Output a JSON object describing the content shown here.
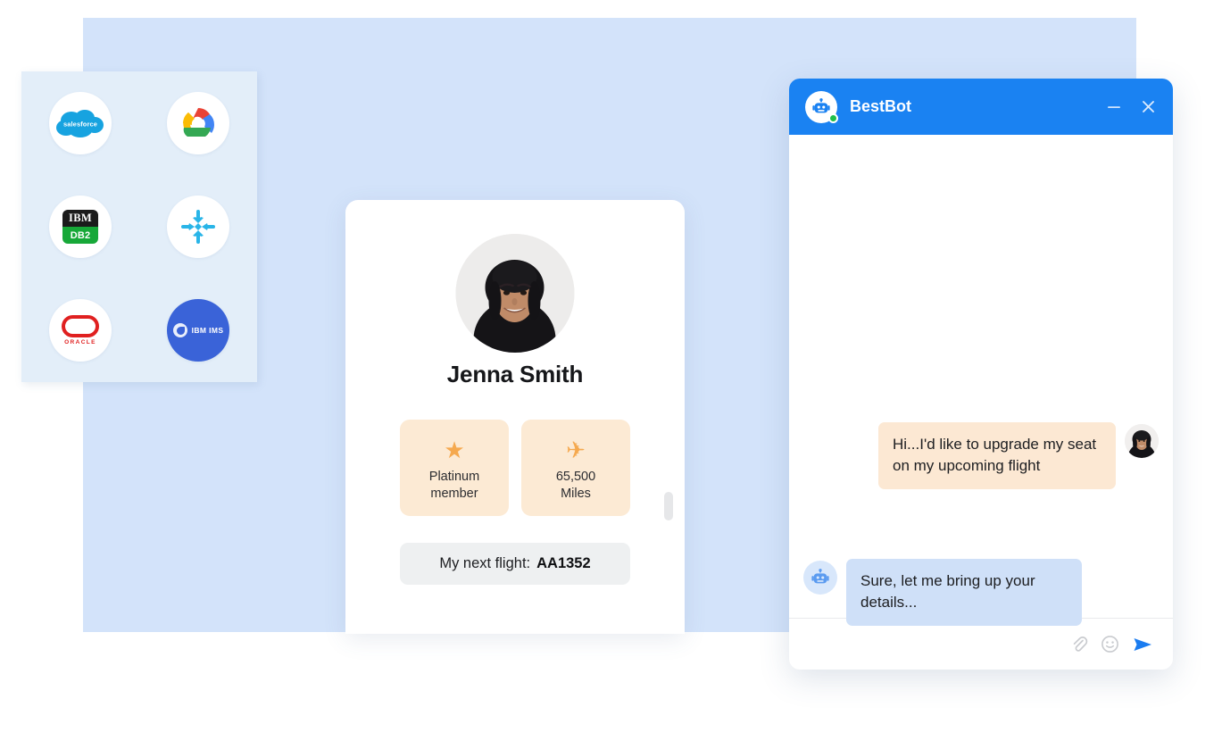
{
  "background": {
    "panel_color": "#d3e3fa",
    "page_color": "#ffffff"
  },
  "integrations_panel": {
    "name": "data-sources-panel",
    "background_color": "#e3eef9",
    "items": [
      {
        "id": "salesforce",
        "label": "salesforce",
        "icon": "salesforce-cloud-icon",
        "color": "#17a3e0"
      },
      {
        "id": "google-cloud",
        "label": "Google Cloud",
        "icon": "google-cloud-icon",
        "color": "#4285f4"
      },
      {
        "id": "ibm-db2",
        "label_top": "IBM",
        "label_bottom": "DB2",
        "icon": "ibm-db2-icon",
        "color": "#17a838"
      },
      {
        "id": "snowflake",
        "label": "Snowflake",
        "icon": "snowflake-icon",
        "color": "#29b5e8"
      },
      {
        "id": "oracle",
        "label": "ORACLE",
        "icon": "oracle-icon",
        "color": "#e02020"
      },
      {
        "id": "ibm-ims",
        "label": "IBM IMS",
        "icon": "ibm-ims-icon",
        "color": "#3a63d8"
      }
    ]
  },
  "profile_card": {
    "name": "Jenna Smith",
    "avatar_alt": "Jenna Smith portrait photo",
    "badges": [
      {
        "icon": "star-icon",
        "glyph": "★",
        "label": "Platinum\nmember",
        "line1": "Platinum",
        "line2": "member"
      },
      {
        "icon": "airplane-icon",
        "glyph": "✈",
        "label": "65,500\nMiles",
        "line1": "65,500",
        "line2": "Miles"
      }
    ],
    "next_flight": {
      "label": "My next flight:",
      "value": "AA1352"
    },
    "badge_bg_color": "#fcead4",
    "badge_icon_color": "#f5a94f"
  },
  "chat_window": {
    "title": "BestBot",
    "header_color": "#1a82f2",
    "status": "online",
    "status_color": "#1fc04a",
    "bot_avatar_icon": "robot-icon",
    "controls": {
      "minimize": "—",
      "close": "✕"
    },
    "messages": [
      {
        "sender": "user",
        "text": "Hi...I'd like to upgrade my seat on my upcoming flight",
        "bubble_color": "#fce8d3",
        "avatar": "user-photo-avatar"
      },
      {
        "sender": "bot",
        "text": "Sure, let me bring up your details...",
        "bubble_color": "#cfe0f8",
        "avatar": "robot-icon"
      }
    ],
    "footer_actions": [
      {
        "id": "attach",
        "icon": "paperclip-icon",
        "color": "#c9cbcf"
      },
      {
        "id": "emoji",
        "icon": "smiley-icon",
        "color": "#c9cbcf"
      },
      {
        "id": "send",
        "icon": "send-arrow-icon",
        "color": "#1a82f2"
      }
    ]
  }
}
